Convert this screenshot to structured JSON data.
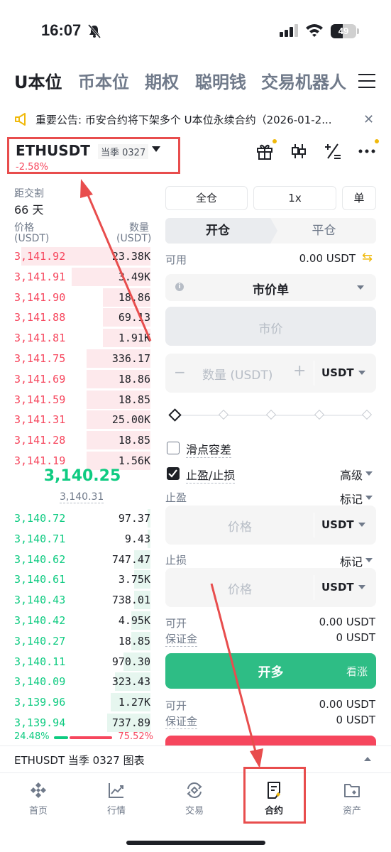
{
  "status": {
    "time": "16:07",
    "battery": "49"
  },
  "top_tabs": [
    "U本位",
    "币本位",
    "期权",
    "聪明钱",
    "交易机器人"
  ],
  "announcement": "重要公告: 币安合约将下架多个 U本位永续合约（2026-01-2...",
  "symbol": {
    "name": "ETHUSDT",
    "badge": "当季 0327",
    "change": "-2.58%"
  },
  "orderbook": {
    "delivery_label": "距交割",
    "delivery_value": "66 天",
    "price_header": "价格",
    "price_unit": "(USDT)",
    "qty_header": "数量",
    "qty_unit": "(USDT)",
    "asks": [
      {
        "price": "3,141.92",
        "qty": "23.38K",
        "depth": 0.95
      },
      {
        "price": "3,141.91",
        "qty": "3.49K",
        "depth": 0.58
      },
      {
        "price": "3,141.90",
        "qty": "18.86",
        "depth": 0.35
      },
      {
        "price": "3,141.88",
        "qty": "69.13",
        "depth": 0.35
      },
      {
        "price": "3,141.81",
        "qty": "1.91K",
        "depth": 0.35
      },
      {
        "price": "3,141.75",
        "qty": "336.17",
        "depth": 0.47
      },
      {
        "price": "3,141.69",
        "qty": "18.86",
        "depth": 0.47
      },
      {
        "price": "3,141.59",
        "qty": "18.85",
        "depth": 0.47
      },
      {
        "price": "3,141.31",
        "qty": "25.00K",
        "depth": 0.47
      },
      {
        "price": "3,141.28",
        "qty": "18.85",
        "depth": 0.47
      },
      {
        "price": "3,141.19",
        "qty": "1.56K",
        "depth": 0.47
      }
    ],
    "mid_price": "3,140.25",
    "mark_price": "3,140.31",
    "bids": [
      {
        "price": "3,140.72",
        "qty": "97.37",
        "depth": 0.02
      },
      {
        "price": "3,140.71",
        "qty": "9.43",
        "depth": 0.02
      },
      {
        "price": "3,140.62",
        "qty": "747.47",
        "depth": 0.12
      },
      {
        "price": "3,140.61",
        "qty": "3.75K",
        "depth": 0.12
      },
      {
        "price": "3,140.43",
        "qty": "738.01",
        "depth": 0.12
      },
      {
        "price": "3,140.42",
        "qty": "4.95K",
        "depth": 0.14
      },
      {
        "price": "3,140.27",
        "qty": "18.85",
        "depth": 0.14
      },
      {
        "price": "3,140.11",
        "qty": "970.30",
        "depth": 0.2
      },
      {
        "price": "3,140.09",
        "qty": "323.43",
        "depth": 0.26
      },
      {
        "price": "3,139.96",
        "qty": "1.27K",
        "depth": 0.29
      },
      {
        "price": "3,139.94",
        "qty": "737.89",
        "depth": 0.32
      }
    ],
    "buy_ratio": "24.48%",
    "sell_ratio": "75.52%"
  },
  "order_form": {
    "margin_mode": "全仓",
    "leverage": "1x",
    "position_mode": "单",
    "tab_open": "开仓",
    "tab_close": "平仓",
    "available_label": "可用",
    "available_value": "0.00 USDT",
    "order_type": "市价单",
    "price_placeholder": "市价",
    "qty_placeholder": "数量 (USDT)",
    "qty_minus": "−",
    "qty_plus": "+",
    "qty_unit": "USDT",
    "slippage_label": "滑点容差",
    "tpsl_label": "止盈/止损",
    "advanced_label": "高级",
    "tp_label": "止盈",
    "tp_trigger": "标记",
    "tp_placeholder": "价格",
    "tp_unit": "USDT",
    "sl_label": "止损",
    "sl_trigger": "标记",
    "sl_placeholder": "价格",
    "sl_unit": "USDT",
    "open_long_label": "可开",
    "open_long_value": "0.00 USDT",
    "margin_long_label": "保证金",
    "margin_long_value": "0 USDT",
    "long_button": "开多",
    "long_hint": "看涨",
    "open_short_label": "可开",
    "open_short_value": "0.00 USDT",
    "margin_short_label": "保证金",
    "margin_short_value": "0 USDT"
  },
  "chart_bar": "ETHUSDT 当季 0327 图表",
  "nav": [
    {
      "label": "首页",
      "icon": "home-icon"
    },
    {
      "label": "行情",
      "icon": "markets-icon"
    },
    {
      "label": "交易",
      "icon": "trade-icon"
    },
    {
      "label": "合约",
      "icon": "futures-icon"
    },
    {
      "label": "资产",
      "icon": "wallet-icon"
    }
  ],
  "colors": {
    "ask": "#f6465d",
    "bid": "#0ecb81",
    "accent": "#f0b90b",
    "annotation": "#e84d4d"
  }
}
